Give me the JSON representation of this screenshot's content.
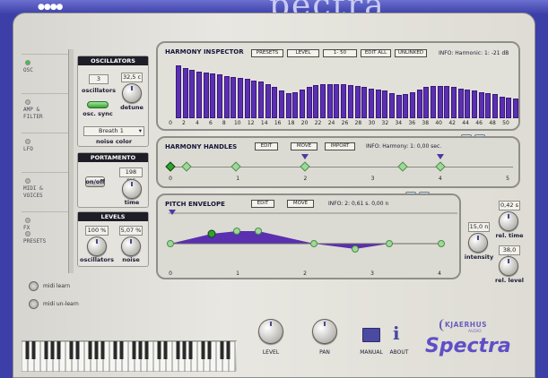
{
  "app": {
    "title_fragment": "pectra"
  },
  "sidebar": {
    "tabs": [
      {
        "label": "OSC",
        "active": true
      },
      {
        "label": "AMP &\nFILTER",
        "active": false
      },
      {
        "label": "LFO",
        "active": false
      },
      {
        "label": "MIDI &\nVOICES",
        "active": false
      },
      {
        "label": "FX",
        "active": false
      },
      {
        "label": "PRESETS",
        "active": false
      }
    ],
    "midi_learn": "midi learn",
    "midi_unlearn": "midi un-learn"
  },
  "oscillators": {
    "title": "OSCILLATORS",
    "count_value": "3",
    "count_label": "oscillators",
    "detune_value": "32,5 c",
    "detune_label": "detune",
    "sync_label": "osc. sync",
    "noise_color_value": "Breath 1",
    "noise_color_label": "noise color"
  },
  "portamento": {
    "title": "PORTAMENTO",
    "onoff_label": "on/off",
    "time_value": "198 ms",
    "time_label": "time"
  },
  "levels": {
    "title": "LEVELS",
    "osc_value": "100 %",
    "osc_label": "oscillators",
    "noise_value": "5,07 %",
    "noise_label": "noise"
  },
  "harmony_inspector": {
    "title": "HARMONY INSPECTOR",
    "buttons": [
      "PRESETS",
      "LEVEL",
      "1- 50",
      "EDIT ALL",
      "UNLINKED"
    ],
    "info": "INFO: Harmonic: 1: -21 dB",
    "x_ticks": [
      "0",
      "2",
      "4",
      "6",
      "8",
      "10",
      "12",
      "14",
      "16",
      "18",
      "20",
      "22",
      "24",
      "26",
      "28",
      "30",
      "32",
      "34",
      "36",
      "38",
      "40",
      "42",
      "44",
      "46",
      "48",
      "50"
    ],
    "bar_values": [
      0.92,
      0.88,
      0.85,
      0.82,
      0.8,
      0.78,
      0.76,
      0.74,
      0.72,
      0.7,
      0.68,
      0.66,
      0.64,
      0.6,
      0.55,
      0.48,
      0.44,
      0.46,
      0.5,
      0.54,
      0.58,
      0.6,
      0.6,
      0.6,
      0.6,
      0.58,
      0.56,
      0.54,
      0.52,
      0.5,
      0.48,
      0.44,
      0.4,
      0.42,
      0.46,
      0.5,
      0.54,
      0.56,
      0.56,
      0.56,
      0.54,
      0.52,
      0.5,
      0.48,
      0.46,
      0.44,
      0.42,
      0.38,
      0.36,
      0.34
    ]
  },
  "harmony_handles": {
    "title": "HARMONY HANDLES",
    "buttons": [
      "EDIT",
      "MOVE",
      "IMPORT"
    ],
    "info": "INFO: Harmony: 1: 0,00 sec.",
    "x_ticks": [
      "0",
      "1",
      "2",
      "3",
      "4",
      "5"
    ]
  },
  "pitch_envelope": {
    "title": "PITCH ENVELOPE",
    "buttons": [
      "EDIT",
      "MOVE"
    ],
    "info": "INFO: 2: 0,61 s. 0,00 n",
    "x_ticks": [
      "0",
      "1",
      "2",
      "3",
      "4"
    ],
    "intensity_value": "15,0 n",
    "intensity_label": "intensity",
    "rel_time_value": "0,42 s",
    "rel_time_label": "rel. time",
    "rel_level_value": "38,0 %",
    "rel_level_label": "rel. level"
  },
  "footer": {
    "level_label": "LEVEL",
    "pan_label": "PAN",
    "manual_label": "MANUAL",
    "about_label": "ABOUT",
    "brand": "KJAERHUS",
    "brand_sub": "AUDIO",
    "product": "Spectra"
  },
  "colors": {
    "accent": "#5a2fb0",
    "panel": "#e2e1d9",
    "led_on": "#3ec24a"
  }
}
